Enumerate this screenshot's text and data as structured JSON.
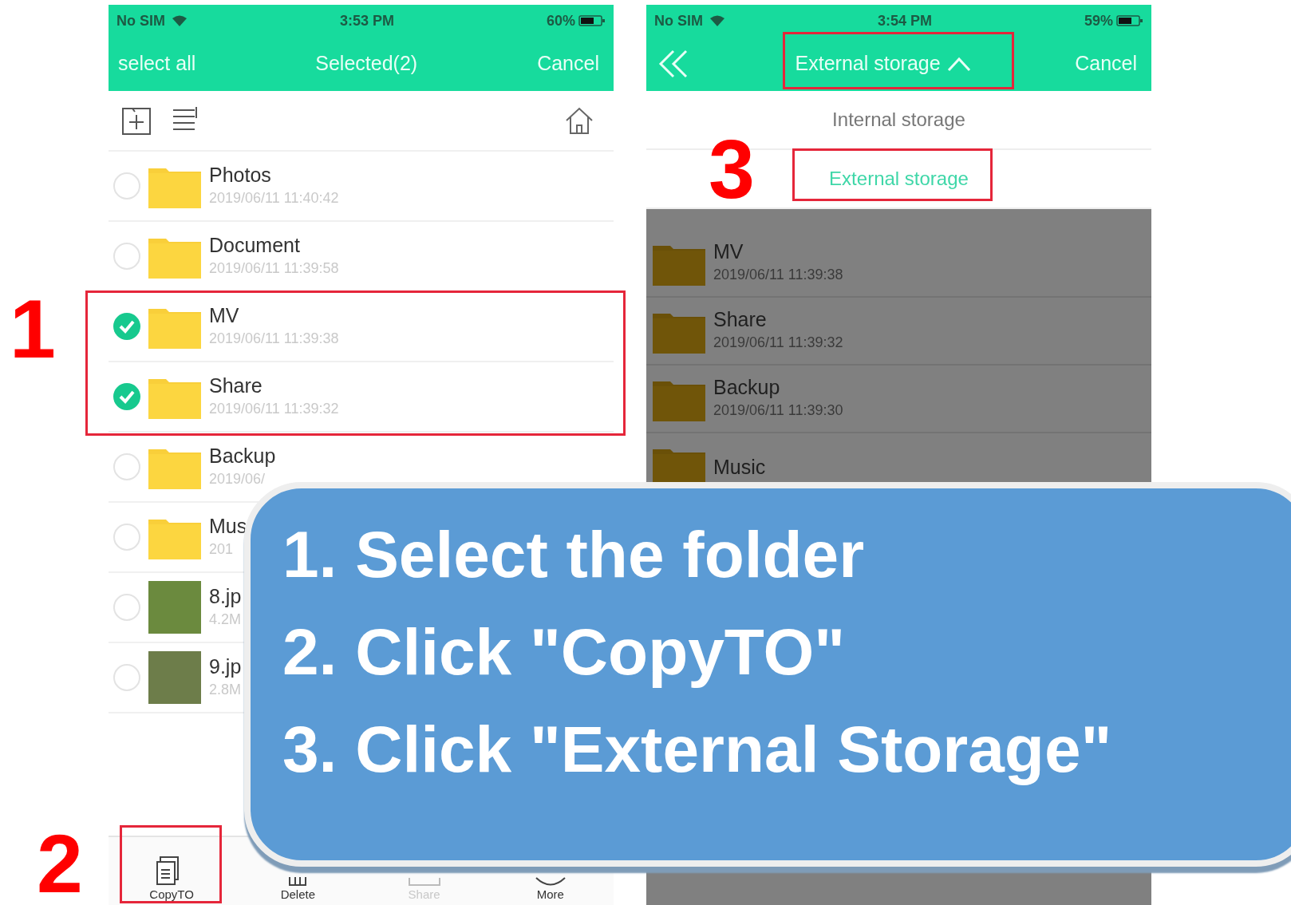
{
  "left_screen": {
    "status_bar": {
      "carrier": "No SIM",
      "time": "3:53 PM",
      "battery": "60%"
    },
    "header": {
      "left": "select all",
      "title": "Selected(2)",
      "right": "Cancel"
    },
    "files": [
      {
        "kind": "folder",
        "name": "Photos",
        "detail": "2019/06/11 11:40:42",
        "selected": false
      },
      {
        "kind": "folder",
        "name": "Document",
        "detail": "2019/06/11 11:39:58",
        "selected": false
      },
      {
        "kind": "folder",
        "name": "MV",
        "detail": "2019/06/11 11:39:38",
        "selected": true
      },
      {
        "kind": "folder",
        "name": "Share",
        "detail": "2019/06/11 11:39:32",
        "selected": true
      },
      {
        "kind": "folder",
        "name": "Backup",
        "detail": "2019/06/",
        "selected": false
      },
      {
        "kind": "folder",
        "name": "Mus",
        "detail": "201",
        "selected": false
      },
      {
        "kind": "photo",
        "name": "8.jp",
        "detail": "4.2M",
        "selected": false
      },
      {
        "kind": "photo",
        "name": "9.jp",
        "detail": "2.8M",
        "selected": false
      }
    ],
    "bottom_bar": [
      {
        "kind": "copy",
        "label": "CopyTO",
        "disabled": false
      },
      {
        "kind": "delete",
        "label": "Delete",
        "disabled": false
      },
      {
        "kind": "share",
        "label": "Share",
        "disabled": true
      },
      {
        "kind": "more",
        "label": "More",
        "disabled": false
      }
    ]
  },
  "right_screen": {
    "status_bar": {
      "carrier": "No SIM",
      "time": "3:54 PM",
      "battery": "59%"
    },
    "header": {
      "title": "External storage",
      "expanded": true,
      "right": "Cancel"
    },
    "dropdown": [
      {
        "label": "Internal storage",
        "selected": false
      },
      {
        "label": "External storage",
        "selected": true
      }
    ],
    "files": [
      {
        "name": "MV",
        "detail": "2019/06/11 11:39:38"
      },
      {
        "name": "Share",
        "detail": "2019/06/11 11:39:32"
      },
      {
        "name": "Backup",
        "detail": "2019/06/11 11:39:30"
      },
      {
        "name": "Music"
      }
    ]
  },
  "step_numbers": [
    "1",
    "2",
    "3"
  ],
  "callout": {
    "lines": [
      "1. Select the folder",
      "2. Click \"CopyTO\"",
      "3. Click \"External Storage\""
    ]
  }
}
